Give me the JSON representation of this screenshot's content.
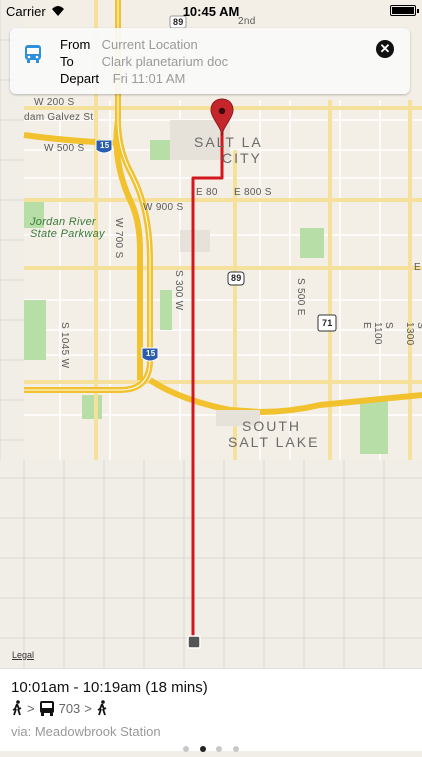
{
  "status_bar": {
    "carrier": "Carrier",
    "time": "10:45 AM"
  },
  "route_card": {
    "from_label": "From",
    "from_value": "Current Location",
    "to_label": "To",
    "to_value": "Clark planetarium doc",
    "depart_label": "Depart",
    "depart_value": "Fri 11:01 AM",
    "close_glyph": "✕"
  },
  "map": {
    "labels": {
      "w200": "W 200 S",
      "galvez": "dam Galvez St",
      "w500": "W 500 S",
      "w900": "W 900 S",
      "jordan": "Jordan River\nState Parkway",
      "s700w": "W 700 S",
      "s300w": "S 300 W",
      "s1045w": "S 1045 W",
      "salt_lake": "SALT LA",
      "city": "CITY",
      "e800": "E 800 S",
      "e800b": "E 80",
      "s500e": "S 500 E",
      "s1100e": "S 1100 E",
      "s1300": "S 1300",
      "south": "SOUTH",
      "salt_lake_b": "SALT LAKE",
      "i15_top": "15",
      "i15_bottom": "15",
      "us89": "89",
      "us71": "71",
      "r89_top": "89",
      "r2nd": "2nd",
      "e_edge": "E"
    },
    "legal": "Legal",
    "colors": {
      "route": "#d3171f",
      "highway": "#f7c836",
      "major_road": "#f5e19b",
      "park": "#a9d99b",
      "land": "#f1eee8"
    }
  },
  "summary": {
    "times": "10:01am - 10:19am (18 mins)",
    "sep1": ">",
    "bus_number": "703",
    "sep2": ">",
    "via": "via: Meadowbrook Station",
    "page_count": 4,
    "active_page": 2
  }
}
